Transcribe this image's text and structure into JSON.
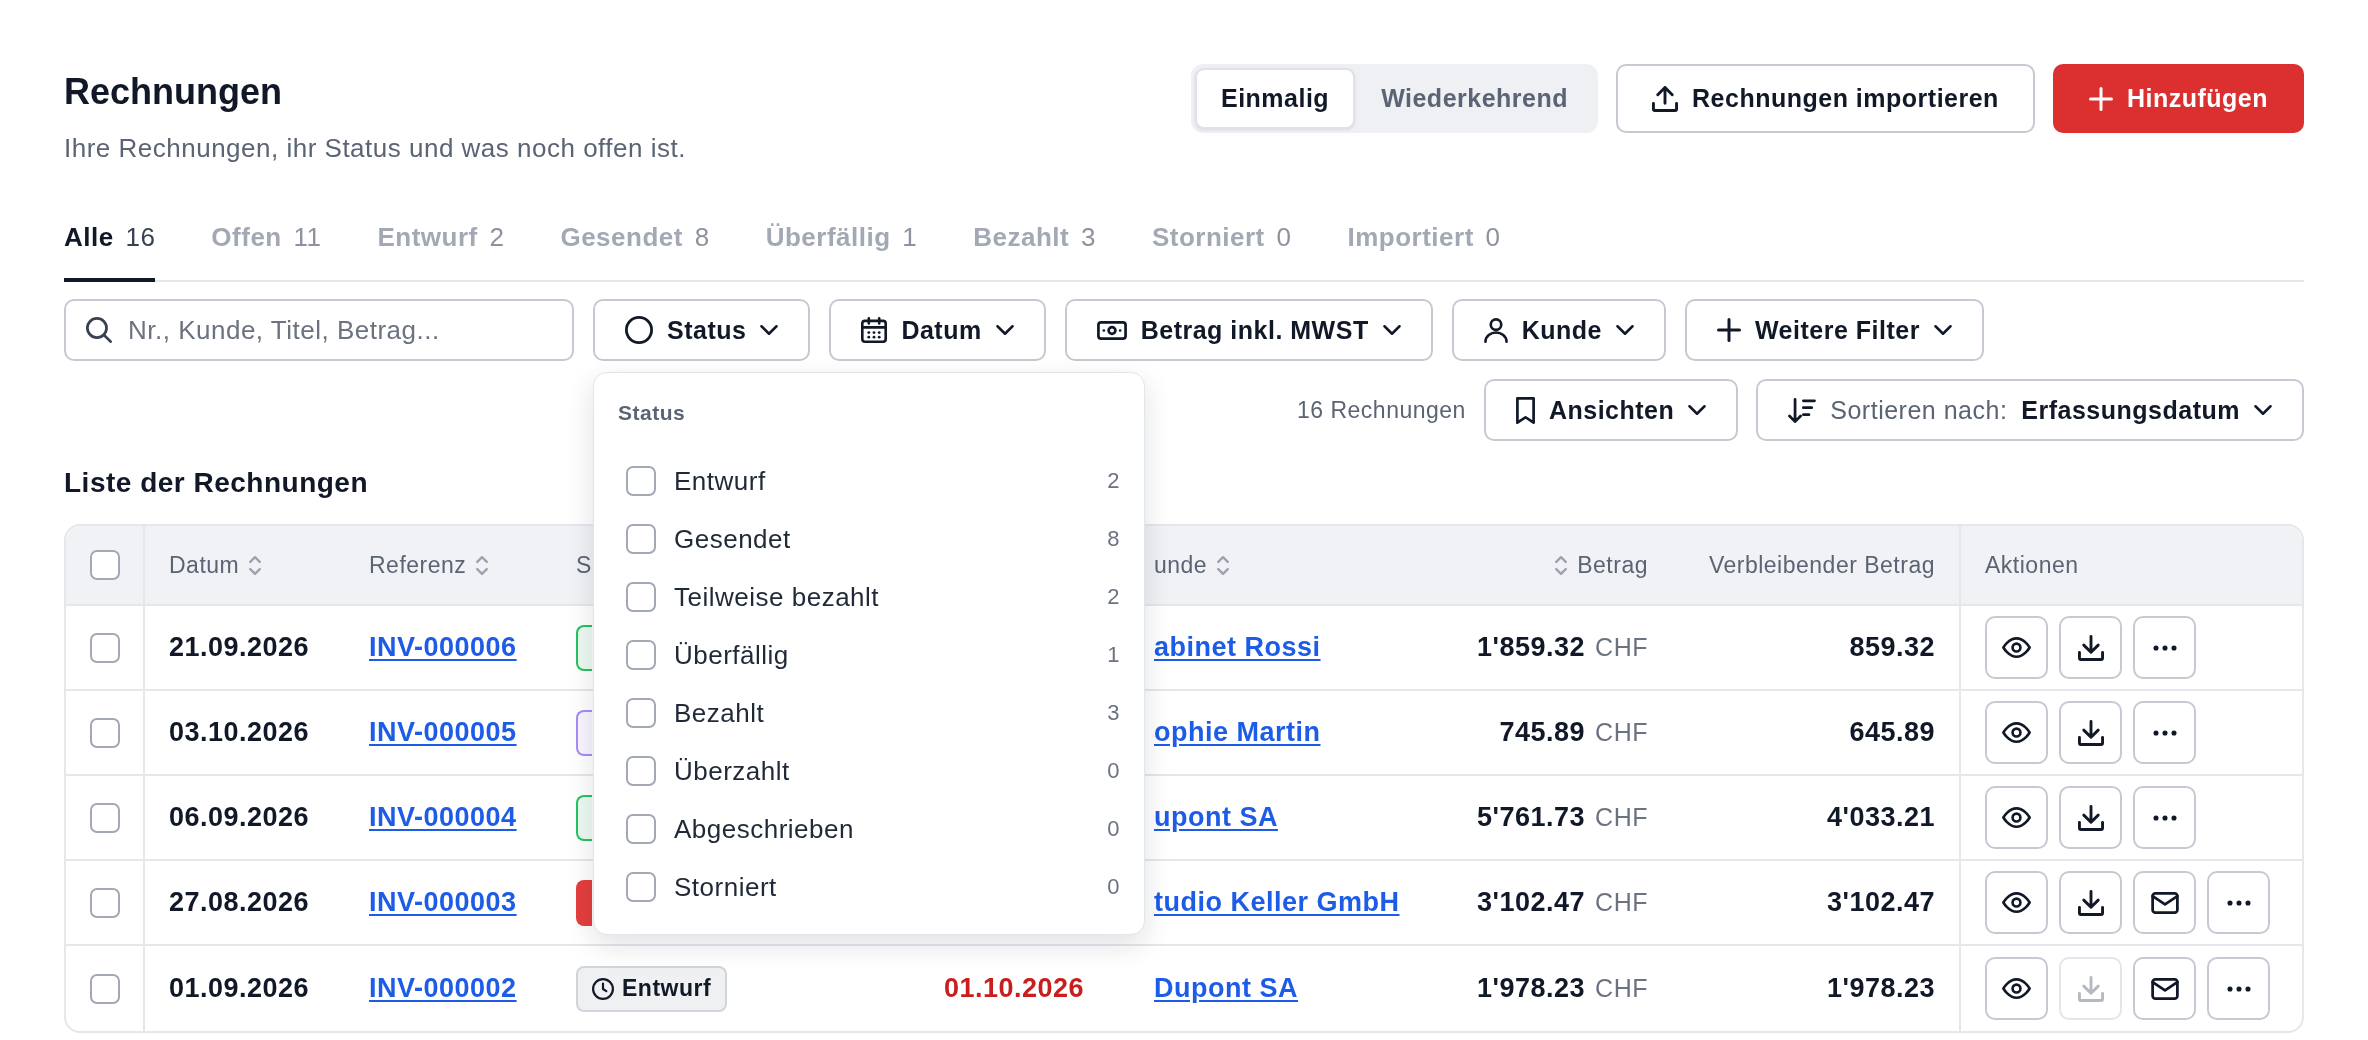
{
  "header": {
    "title": "Rechnungen",
    "subtitle": "Ihre Rechnungen, ihr Status und was noch offen ist."
  },
  "mode_toggle": [
    {
      "label": "Einmalig",
      "selected": true
    },
    {
      "label": "Wiederkehrend",
      "selected": false
    }
  ],
  "actions": [
    {
      "kind": "import",
      "label": "Rechnungen importieren"
    },
    {
      "kind": "add",
      "label": "Hinzufügen"
    }
  ],
  "tabs": [
    {
      "label": "Alle",
      "count": "16",
      "selected": true
    },
    {
      "label": "Offen",
      "count": "11",
      "selected": false
    },
    {
      "label": "Entwurf",
      "count": "2",
      "selected": false
    },
    {
      "label": "Gesendet",
      "count": "8",
      "selected": false
    },
    {
      "label": "Überfällig",
      "count": "1",
      "selected": false
    },
    {
      "label": "Bezahlt",
      "count": "3",
      "selected": false
    },
    {
      "label": "Storniert",
      "count": "0",
      "selected": false
    },
    {
      "label": "Importiert",
      "count": "0",
      "selected": false
    }
  ],
  "search": {
    "placeholder": "Nr., Kunde, Titel, Betrag..."
  },
  "filters": [
    {
      "kind": "status",
      "label": "Status",
      "menu": {
        "title": "Status",
        "options": [
          {
            "label": "Entwurf",
            "count": "2",
            "checked": false
          },
          {
            "label": "Gesendet",
            "count": "8",
            "checked": false
          },
          {
            "label": "Teilweise bezahlt",
            "count": "2",
            "checked": false
          },
          {
            "label": "Überfällig",
            "count": "1",
            "checked": false
          },
          {
            "label": "Bezahlt",
            "count": "3",
            "checked": false
          },
          {
            "label": "Überzahlt",
            "count": "0",
            "checked": false
          },
          {
            "label": "Abgeschrieben",
            "count": "0",
            "checked": false
          },
          {
            "label": "Storniert",
            "count": "0",
            "checked": false
          }
        ]
      }
    },
    {
      "kind": "date",
      "label": "Datum"
    },
    {
      "kind": "amount",
      "label": "Betrag inkl. MWST"
    },
    {
      "kind": "customer",
      "label": "Kunde"
    },
    {
      "kind": "more",
      "label": "Weitere Filter"
    }
  ],
  "result_count": "16 Rechnungen",
  "views": {
    "label": "Ansichten"
  },
  "sort": {
    "label": "Sortieren nach:",
    "value": "Erfassungsdatum"
  },
  "table": {
    "title": "Liste der Rechnungen",
    "select_all": {
      "checked": false
    },
    "columns": [
      {
        "kind": "date",
        "label": "Datum",
        "sortable": true
      },
      {
        "kind": "reference",
        "label": "Referenz",
        "sortable": true
      },
      {
        "kind": "status",
        "label": "S",
        "sortable": false
      },
      {
        "kind": "customer",
        "label": "unde",
        "sortable": true
      },
      {
        "kind": "amount",
        "label": "Betrag",
        "sortable": true
      },
      {
        "kind": "remaining",
        "label": "Verbleibender Betrag",
        "sortable": false
      },
      {
        "kind": "actions",
        "label": "Aktionen",
        "sortable": false
      }
    ],
    "rows": [
      {
        "checked": false,
        "date": "21.09.2026",
        "reference": "INV-000006",
        "status": {
          "color": "#22c55e",
          "solid": false
        },
        "customer": "abinet Rossi",
        "amount": "1'859.32",
        "currency": "CHF",
        "remaining": "859.32",
        "actions": [
          {
            "kind": "view",
            "disabled": false
          },
          {
            "kind": "download",
            "disabled": false
          },
          {
            "kind": "more",
            "disabled": false
          }
        ]
      },
      {
        "checked": false,
        "date": "03.10.2026",
        "reference": "INV-000005",
        "status": {
          "color": "#a78bfa",
          "solid": false
        },
        "customer": "ophie Martin",
        "amount": "745.89",
        "currency": "CHF",
        "remaining": "645.89",
        "actions": [
          {
            "kind": "view",
            "disabled": false
          },
          {
            "kind": "download",
            "disabled": false
          },
          {
            "kind": "more",
            "disabled": false
          }
        ]
      },
      {
        "checked": false,
        "date": "06.09.2026",
        "reference": "INV-000004",
        "status": {
          "color": "#22c55e",
          "solid": false
        },
        "customer": "upont SA",
        "amount": "5'761.73",
        "currency": "CHF",
        "remaining": "4'033.21",
        "actions": [
          {
            "kind": "view",
            "disabled": false
          },
          {
            "kind": "download",
            "disabled": false
          },
          {
            "kind": "more",
            "disabled": false
          }
        ]
      },
      {
        "checked": false,
        "date": "27.08.2026",
        "reference": "INV-000003",
        "status": {
          "color": "#e53e3e",
          "solid": true
        },
        "customer": "tudio Keller GmbH",
        "amount": "3'102.47",
        "currency": "CHF",
        "remaining": "3'102.47",
        "actions": [
          {
            "kind": "view",
            "disabled": false
          },
          {
            "kind": "download",
            "disabled": false
          },
          {
            "kind": "mail",
            "disabled": false
          },
          {
            "kind": "more",
            "disabled": false
          }
        ]
      },
      {
        "checked": false,
        "date": "01.09.2026",
        "reference": "INV-000002",
        "status": {
          "label": "Entwurf",
          "color": "#d1d5db",
          "solid": false
        },
        "due": {
          "text": "01.10.2026",
          "overdue": true
        },
        "customer": "Dupont SA",
        "amount": "1'978.23",
        "currency": "CHF",
        "remaining": "1'978.23",
        "actions": [
          {
            "kind": "view",
            "disabled": false
          },
          {
            "kind": "download",
            "disabled": true
          },
          {
            "kind": "mail",
            "disabled": false
          },
          {
            "kind": "more",
            "disabled": false
          }
        ]
      }
    ]
  }
}
